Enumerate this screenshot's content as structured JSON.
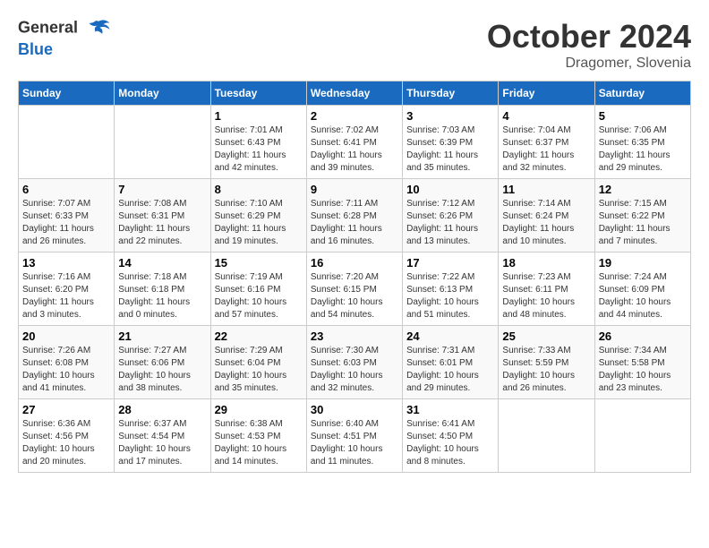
{
  "header": {
    "logo_general": "General",
    "logo_blue": "Blue",
    "month_title": "October 2024",
    "location": "Dragomer, Slovenia"
  },
  "days_of_week": [
    "Sunday",
    "Monday",
    "Tuesday",
    "Wednesday",
    "Thursday",
    "Friday",
    "Saturday"
  ],
  "weeks": [
    [
      {
        "day": "",
        "info": ""
      },
      {
        "day": "",
        "info": ""
      },
      {
        "day": "1",
        "info": "Sunrise: 7:01 AM\nSunset: 6:43 PM\nDaylight: 11 hours and 42 minutes."
      },
      {
        "day": "2",
        "info": "Sunrise: 7:02 AM\nSunset: 6:41 PM\nDaylight: 11 hours and 39 minutes."
      },
      {
        "day": "3",
        "info": "Sunrise: 7:03 AM\nSunset: 6:39 PM\nDaylight: 11 hours and 35 minutes."
      },
      {
        "day": "4",
        "info": "Sunrise: 7:04 AM\nSunset: 6:37 PM\nDaylight: 11 hours and 32 minutes."
      },
      {
        "day": "5",
        "info": "Sunrise: 7:06 AM\nSunset: 6:35 PM\nDaylight: 11 hours and 29 minutes."
      }
    ],
    [
      {
        "day": "6",
        "info": "Sunrise: 7:07 AM\nSunset: 6:33 PM\nDaylight: 11 hours and 26 minutes."
      },
      {
        "day": "7",
        "info": "Sunrise: 7:08 AM\nSunset: 6:31 PM\nDaylight: 11 hours and 22 minutes."
      },
      {
        "day": "8",
        "info": "Sunrise: 7:10 AM\nSunset: 6:29 PM\nDaylight: 11 hours and 19 minutes."
      },
      {
        "day": "9",
        "info": "Sunrise: 7:11 AM\nSunset: 6:28 PM\nDaylight: 11 hours and 16 minutes."
      },
      {
        "day": "10",
        "info": "Sunrise: 7:12 AM\nSunset: 6:26 PM\nDaylight: 11 hours and 13 minutes."
      },
      {
        "day": "11",
        "info": "Sunrise: 7:14 AM\nSunset: 6:24 PM\nDaylight: 11 hours and 10 minutes."
      },
      {
        "day": "12",
        "info": "Sunrise: 7:15 AM\nSunset: 6:22 PM\nDaylight: 11 hours and 7 minutes."
      }
    ],
    [
      {
        "day": "13",
        "info": "Sunrise: 7:16 AM\nSunset: 6:20 PM\nDaylight: 11 hours and 3 minutes."
      },
      {
        "day": "14",
        "info": "Sunrise: 7:18 AM\nSunset: 6:18 PM\nDaylight: 11 hours and 0 minutes."
      },
      {
        "day": "15",
        "info": "Sunrise: 7:19 AM\nSunset: 6:16 PM\nDaylight: 10 hours and 57 minutes."
      },
      {
        "day": "16",
        "info": "Sunrise: 7:20 AM\nSunset: 6:15 PM\nDaylight: 10 hours and 54 minutes."
      },
      {
        "day": "17",
        "info": "Sunrise: 7:22 AM\nSunset: 6:13 PM\nDaylight: 10 hours and 51 minutes."
      },
      {
        "day": "18",
        "info": "Sunrise: 7:23 AM\nSunset: 6:11 PM\nDaylight: 10 hours and 48 minutes."
      },
      {
        "day": "19",
        "info": "Sunrise: 7:24 AM\nSunset: 6:09 PM\nDaylight: 10 hours and 44 minutes."
      }
    ],
    [
      {
        "day": "20",
        "info": "Sunrise: 7:26 AM\nSunset: 6:08 PM\nDaylight: 10 hours and 41 minutes."
      },
      {
        "day": "21",
        "info": "Sunrise: 7:27 AM\nSunset: 6:06 PM\nDaylight: 10 hours and 38 minutes."
      },
      {
        "day": "22",
        "info": "Sunrise: 7:29 AM\nSunset: 6:04 PM\nDaylight: 10 hours and 35 minutes."
      },
      {
        "day": "23",
        "info": "Sunrise: 7:30 AM\nSunset: 6:03 PM\nDaylight: 10 hours and 32 minutes."
      },
      {
        "day": "24",
        "info": "Sunrise: 7:31 AM\nSunset: 6:01 PM\nDaylight: 10 hours and 29 minutes."
      },
      {
        "day": "25",
        "info": "Sunrise: 7:33 AM\nSunset: 5:59 PM\nDaylight: 10 hours and 26 minutes."
      },
      {
        "day": "26",
        "info": "Sunrise: 7:34 AM\nSunset: 5:58 PM\nDaylight: 10 hours and 23 minutes."
      }
    ],
    [
      {
        "day": "27",
        "info": "Sunrise: 6:36 AM\nSunset: 4:56 PM\nDaylight: 10 hours and 20 minutes."
      },
      {
        "day": "28",
        "info": "Sunrise: 6:37 AM\nSunset: 4:54 PM\nDaylight: 10 hours and 17 minutes."
      },
      {
        "day": "29",
        "info": "Sunrise: 6:38 AM\nSunset: 4:53 PM\nDaylight: 10 hours and 14 minutes."
      },
      {
        "day": "30",
        "info": "Sunrise: 6:40 AM\nSunset: 4:51 PM\nDaylight: 10 hours and 11 minutes."
      },
      {
        "day": "31",
        "info": "Sunrise: 6:41 AM\nSunset: 4:50 PM\nDaylight: 10 hours and 8 minutes."
      },
      {
        "day": "",
        "info": ""
      },
      {
        "day": "",
        "info": ""
      }
    ]
  ]
}
